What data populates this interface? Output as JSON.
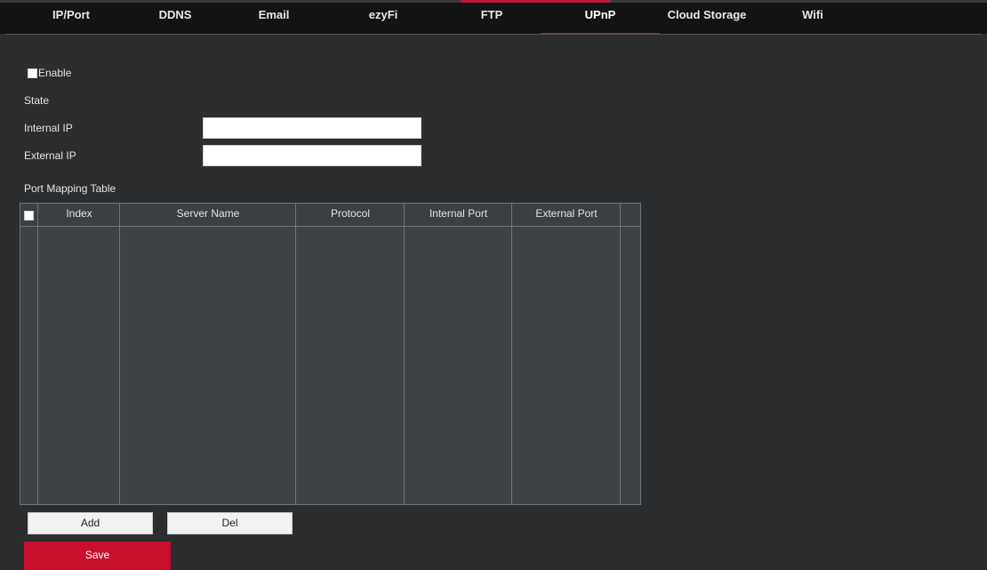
{
  "tabs": [
    {
      "label": "IP/Port"
    },
    {
      "label": "DDNS"
    },
    {
      "label": "Email"
    },
    {
      "label": "ezyFi"
    },
    {
      "label": "FTP"
    },
    {
      "label": "UPnP",
      "active": true
    },
    {
      "label": "Cloud Storage"
    },
    {
      "label": "Wifi"
    }
  ],
  "form": {
    "enable_label": "Enable",
    "enable_checked": false,
    "state_label": "State",
    "internal_ip_label": "Internal IP",
    "internal_ip_value": "",
    "external_ip_label": "External IP",
    "external_ip_value": ""
  },
  "port_mapping": {
    "title": "Port Mapping Table",
    "columns": [
      "Index",
      "Server Name",
      "Protocol",
      "Internal Port",
      "External Port"
    ],
    "rows": []
  },
  "buttons": {
    "add": "Add",
    "del": "Del",
    "save": "Save"
  },
  "colors": {
    "accent": "#c8102e",
    "background": "#2b2d2f",
    "tabbar": "#111315"
  }
}
